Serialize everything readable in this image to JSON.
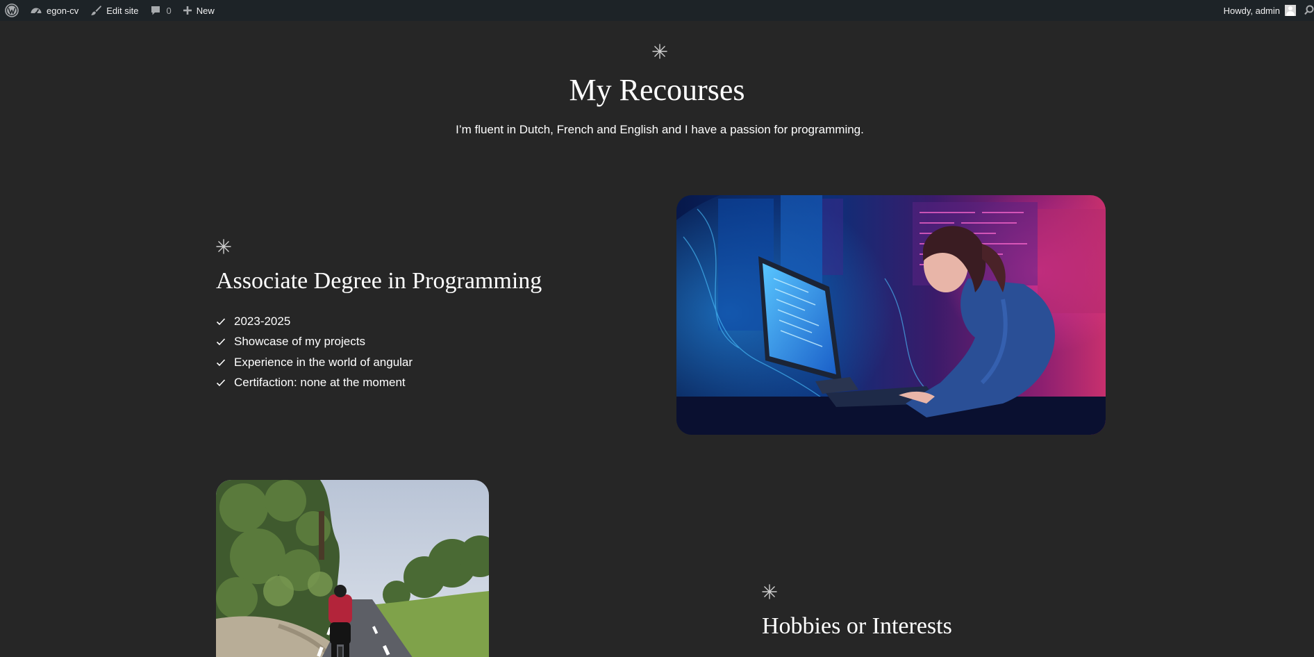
{
  "admin_bar": {
    "wp_logo_icon": "wordpress-logo-icon",
    "site_name": "egon-cv",
    "edit_site_label": "Edit site",
    "comments_count": "0",
    "new_label": "New",
    "greeting": "Howdy, admin"
  },
  "hero": {
    "title": "My Recourses",
    "subtitle": "I’m fluent in Dutch, French and English and I have a passion for programming."
  },
  "education": {
    "title": "Associate Degree in Programming",
    "items": [
      "2023-2025",
      "Showcase of my projects",
      "Experience in the world of angular",
      "Certifaction: none at the moment"
    ],
    "image_icon": "woman-coding-at-computer-image"
  },
  "hobbies": {
    "title": "Hobbies or Interests",
    "image_icon": "cyclist-on-road-image"
  },
  "colors": {
    "background": "#262626",
    "admin_bar": "#1d2327",
    "text": "#ffffff",
    "asterisk": "#cfcfcf"
  }
}
